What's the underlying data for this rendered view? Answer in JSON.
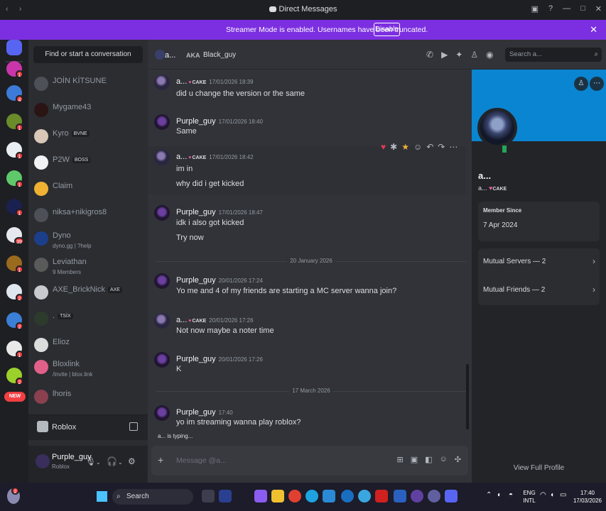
{
  "window": {
    "title": "Direct Messages",
    "controls": [
      "▣",
      "?",
      "—",
      "□",
      "✕"
    ],
    "nav": "‹ ›"
  },
  "banner": {
    "message": "Streamer Mode is enabled. Usernames have been truncated.",
    "button": "Disable",
    "close": "✕"
  },
  "rail": {
    "badges": [
      "1",
      "4",
      "1",
      "1",
      "1",
      "1",
      "39",
      "1",
      "2",
      "2",
      "1",
      "2",
      "NEW"
    ]
  },
  "dm_search": "Find or start a conversation",
  "dms": [
    {
      "name": "JOİN KİTSUNE",
      "sub": "",
      "tag": ""
    },
    {
      "name": "Mygame43",
      "sub": "",
      "tag": ""
    },
    {
      "name": "Kyro",
      "sub": "",
      "tag": "BVNE"
    },
    {
      "name": "P2W",
      "sub": "",
      "tag": "BOSS"
    },
    {
      "name": "Claim",
      "sub": "",
      "tag": ""
    },
    {
      "name": "niksa+nikigros8",
      "sub": "",
      "tag": ""
    },
    {
      "name": "Dyno",
      "sub": "dyno.gg | ?help",
      "tag": ""
    },
    {
      "name": "Leviathan",
      "sub": "9 Members",
      "tag": ""
    },
    {
      "name": "AXE_BrickNick",
      "sub": "",
      "tag": "AXE"
    },
    {
      "name": ".",
      "sub": "",
      "tag": "TSİX"
    },
    {
      "name": "Elioz",
      "sub": "",
      "tag": ""
    },
    {
      "name": "Bloxlink",
      "sub": "/invite | blox.link",
      "tag": ""
    },
    {
      "name": "lhoris",
      "sub": "",
      "tag": ""
    }
  ],
  "activity": {
    "label": "Roblox"
  },
  "user": {
    "name": "Purple_guy",
    "status": "Roblox"
  },
  "header": {
    "name": "a...",
    "aka": "AKA",
    "aka_name": "Black_guy",
    "search_placeholder": "Search a..."
  },
  "messages": [
    {
      "author": "a...",
      "role": "CAKE",
      "time": "17/01/2026 18:39",
      "lines": [
        "did u change the version or the same"
      ]
    },
    {
      "author": "Purple_guy",
      "role": "",
      "time": "17/01/2026 18:40",
      "lines": [
        "Same"
      ]
    },
    {
      "author": "a...",
      "role": "CAKE",
      "time": "17/01/2026 18:42",
      "lines": [
        "im in",
        "why did i get kicked"
      ]
    },
    {
      "author": "Purple_guy",
      "role": "",
      "time": "17/01/2026 18:47",
      "lines": [
        "idk i also got kicked",
        "Try now"
      ]
    },
    {
      "author": "Purple_guy",
      "role": "",
      "time": "20/01/2026 17:24",
      "lines": [
        "Yo me and 4 of my friends are starting a MC server wanna join?"
      ]
    },
    {
      "author": "a...",
      "role": "CAKE",
      "time": "20/01/2026 17:26",
      "lines": [
        "Not now maybe a noter time"
      ]
    },
    {
      "author": "Purple_guy",
      "role": "",
      "time": "20/01/2026 17:26",
      "lines": [
        "K"
      ]
    },
    {
      "author": "Purple_guy",
      "role": "",
      "time": "17:40",
      "lines": [
        "yo im streaming wanna play roblox?"
      ]
    }
  ],
  "dividers": [
    "20 January 2026",
    "17 March 2026"
  ],
  "typing": "a... is typing...",
  "composer": {
    "placeholder": "Message @a..."
  },
  "profile": {
    "display_name": "a...",
    "username": "a...",
    "role": "CAKE",
    "member_since_label": "Member Since",
    "member_since": "7 Apr 2024",
    "mutual_servers": "Mutual Servers — 2",
    "mutual_friends": "Mutual Friends — 2",
    "view_full": "View Full Profile"
  },
  "taskbar": {
    "search": "Search",
    "lang1": "ENG",
    "lang2": "INTL",
    "time": "17:40",
    "date": "17/03/2026",
    "notif": "2"
  }
}
